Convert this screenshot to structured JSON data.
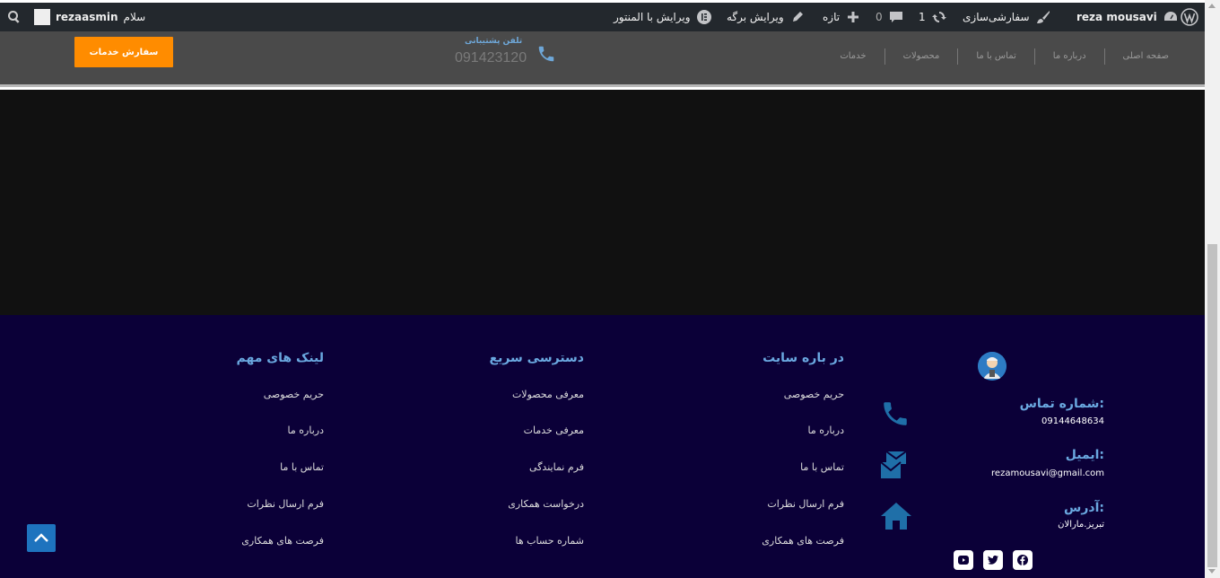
{
  "admin_bar": {
    "greeting": "سلام",
    "username": "rezaasmin",
    "site_name": "reza mousavi",
    "customize": "سفارشی‌سازی",
    "updates_count": "1",
    "comments_count": "0",
    "new_label": "تازه",
    "edit_page": "ویرایش برگه",
    "edit_elementor": "ویرایش با المنتور"
  },
  "header": {
    "order_button": "سفارش خدمات",
    "support_label": "تلفن پشتیبانی",
    "support_phone": "091423120",
    "nav": [
      "صفحه اصلی",
      "درباره ما",
      "تماس با ما",
      "محصولات",
      "خدمات"
    ]
  },
  "footer": {
    "about": {
      "title": "در باره سایت",
      "links": [
        "حریم خصوصی",
        "درباره ما",
        "تماس با ما",
        "فرم ارسال نظرات",
        "فرصت های همکاری"
      ]
    },
    "quick": {
      "title": "دسترسی سریع",
      "links": [
        "معرفی محصولات",
        "معرفی خدمات",
        "فرم نمایندگی",
        "درخواست همکاری",
        "شماره حساب ها"
      ]
    },
    "important": {
      "title": "لینک های مهم",
      "links": [
        "حریم خصوصی",
        "درباره ما",
        "تماس با ما",
        "فرم ارسال نظرات",
        "فرصت های همکاری"
      ]
    },
    "contact": {
      "phone_label": "شماره تماس:",
      "phone": "09144648634",
      "email_label": "ایمیل:",
      "email": "rezamousavi@gmail.com",
      "address_label": "آدرس:",
      "address": "تبریز.مارالان"
    }
  },
  "colors": {
    "admin_bar": "#23282d",
    "header_bg": "#4a4a4a",
    "accent_orange": "#ff8c00",
    "footer_bg": "#0b0038",
    "footer_title": "#6aa8e0",
    "icon_blue": "#1f6fa8"
  }
}
